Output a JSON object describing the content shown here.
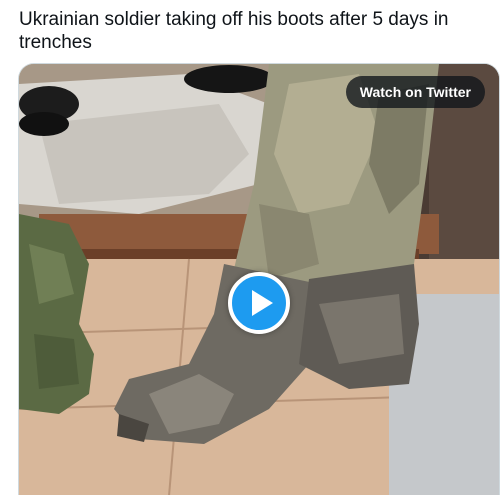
{
  "tweet": {
    "text": "Ukrainian soldier taking off his boots after 5 days in trenches"
  },
  "media": {
    "watch_label": "Watch on Twitter",
    "play_icon": "play-icon",
    "accent_color": "#1d9bf0"
  }
}
